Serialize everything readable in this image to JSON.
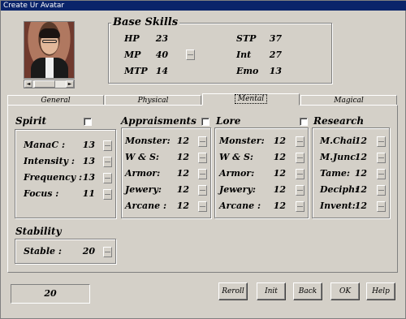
{
  "window": {
    "title": "Create Ur Avatar"
  },
  "base_skills": {
    "title": "Base Skills",
    "stats": [
      {
        "label": "HP",
        "value": "23"
      },
      {
        "label": "MP",
        "value": "40"
      },
      {
        "label": "MTP",
        "value": "14"
      },
      {
        "label": "STP",
        "value": "37"
      },
      {
        "label": "Int",
        "value": "27"
      },
      {
        "label": "Emo",
        "value": "13"
      }
    ]
  },
  "tabs": [
    {
      "label": "General"
    },
    {
      "label": "Physical"
    },
    {
      "label": "Mental",
      "active": true
    },
    {
      "label": "Magical"
    }
  ],
  "spirit": {
    "title": "Spirit",
    "items": [
      {
        "label": "ManaC :",
        "value": "13"
      },
      {
        "label": "Intensity :",
        "value": "13"
      },
      {
        "label": "Frequency :",
        "value": "13"
      },
      {
        "label": "Focus :",
        "value": "11"
      }
    ]
  },
  "appraisments": {
    "title": "Appraisments",
    "items": [
      {
        "label": "Monster:",
        "value": "12"
      },
      {
        "label": "W & S:",
        "value": "12"
      },
      {
        "label": "Armor:",
        "value": "12"
      },
      {
        "label": "Jewery:",
        "value": "12"
      },
      {
        "label": "Arcane :",
        "value": "12"
      }
    ]
  },
  "lore": {
    "title": "Lore",
    "items": [
      {
        "label": "Monster:",
        "value": "12"
      },
      {
        "label": "W & S:",
        "value": "12"
      },
      {
        "label": "Armor:",
        "value": "12"
      },
      {
        "label": "Jewery:",
        "value": "12"
      },
      {
        "label": "Arcane :",
        "value": "12"
      }
    ]
  },
  "research": {
    "title": "Research",
    "items": [
      {
        "label": "M.Chai",
        "value": "12"
      },
      {
        "label": "M.Junc",
        "value": "12"
      },
      {
        "label": "Tame:",
        "value": "12"
      },
      {
        "label": "Deciph:",
        "value": "12"
      },
      {
        "label": "Invent:",
        "value": "12"
      }
    ]
  },
  "stability": {
    "title": "Stability",
    "items": [
      {
        "label": "Stable :",
        "value": "20"
      }
    ]
  },
  "points_remaining": "20",
  "buttons": {
    "reroll": "Reroll",
    "init": "Init",
    "back": "Back",
    "ok": "OK",
    "help": "Help"
  }
}
